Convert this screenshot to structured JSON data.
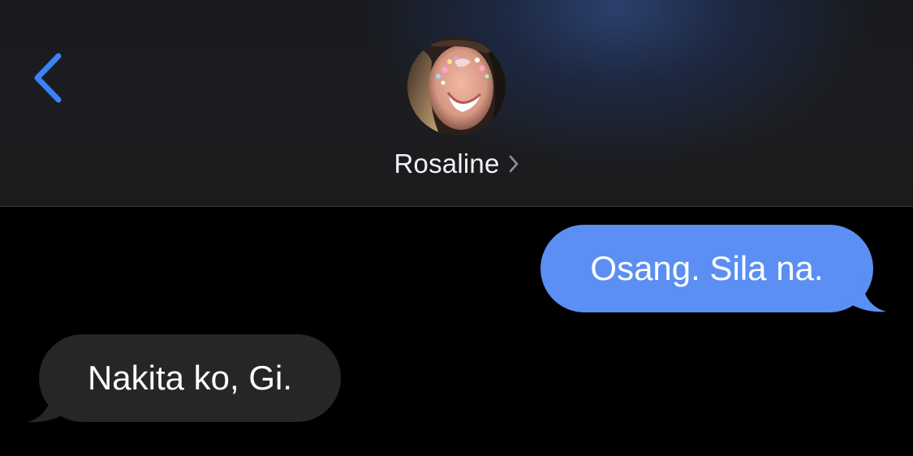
{
  "header": {
    "back_icon": "chevron-left-icon",
    "avatar_icon": "contact-photo",
    "contact_name": "Rosaline",
    "contact_chevron_icon": "chevron-right-icon"
  },
  "messages": [
    {
      "direction": "sent",
      "text": "Osang. Sila na."
    },
    {
      "direction": "received",
      "text": "Nakita ko, Gi."
    }
  ],
  "colors": {
    "accent": "#3b82f6",
    "sent_bubble": "#5b8ff3",
    "received_bubble": "#262629",
    "background": "#000000"
  }
}
